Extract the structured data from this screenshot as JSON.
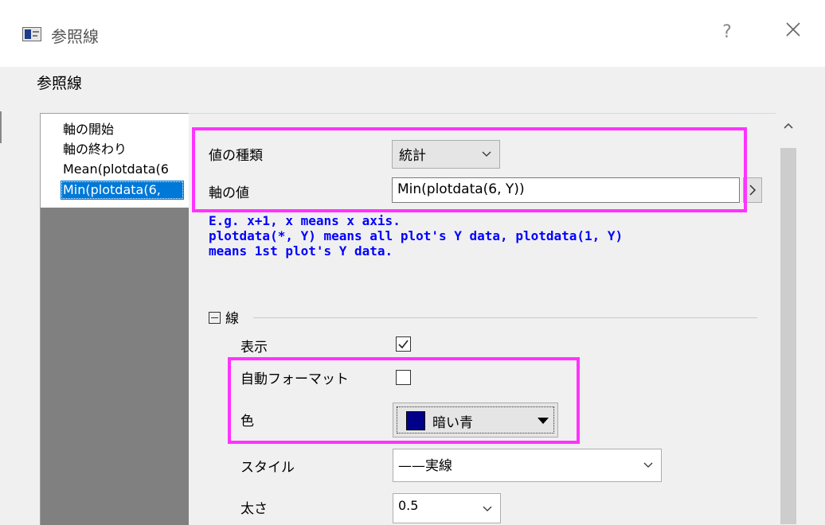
{
  "window": {
    "title": "参照線",
    "help": "?"
  },
  "section_title": "参照線",
  "list": {
    "items": [
      {
        "label": "軸の開始"
      },
      {
        "label": "軸の終わり"
      },
      {
        "label": "Mean(plotdata(6"
      },
      {
        "label": "Min(plotdata(6,"
      }
    ],
    "selected_index": 3
  },
  "form": {
    "value_type": {
      "label": "値の種類",
      "value": "統計"
    },
    "axis_value": {
      "label": "軸の値",
      "value": "Min(plotdata(6, Y))",
      "button": ">"
    },
    "hint": "E.g. x+1, x means x axis.\nplotdata(*, Y) means all plot's Y data, plotdata(1, Y)\nmeans 1st plot's Y data.",
    "line_group": {
      "title": "線",
      "show": {
        "label": "表示",
        "checked": true
      },
      "auto_format": {
        "label": "自動フォーマット",
        "checked": false
      },
      "color": {
        "label": "色",
        "value": "暗い青",
        "swatch": "#00008b"
      },
      "style": {
        "label": "スタイル",
        "value": "——実線"
      },
      "width": {
        "label": "太さ",
        "value": "0.5"
      }
    }
  },
  "colors": {
    "highlight": "#ff33ff",
    "selection": "#0078d7",
    "hint": "#0000ff"
  }
}
